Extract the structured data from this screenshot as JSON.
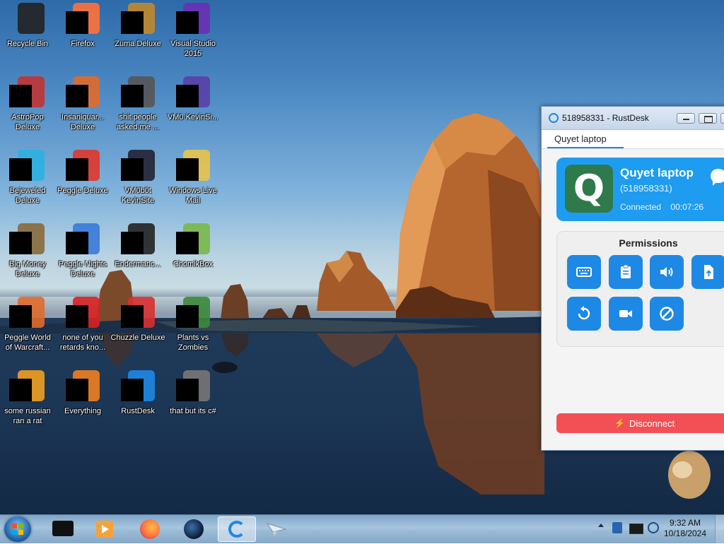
{
  "desktop": {
    "icons": [
      {
        "label": "Recycle Bin"
      },
      {
        "label": "Firefox"
      },
      {
        "label": "Zuma Deluxe"
      },
      {
        "label": "Visual Studio 2015"
      },
      {
        "label": "AstroPop Deluxe"
      },
      {
        "label": "Insaniquar... Deluxe"
      },
      {
        "label": "shit people asked me ..."
      },
      {
        "label": "VM0 KevinSi..."
      },
      {
        "label": "Bejeweled Deluxe"
      },
      {
        "label": "Peggle Deluxe"
      },
      {
        "label": "VM0b0t KevinSite"
      },
      {
        "label": "Windows Live Mail"
      },
      {
        "label": "Big Money Deluxe"
      },
      {
        "label": "Peggle Nights Deluxe"
      },
      {
        "label": "Endermanc..."
      },
      {
        "label": "ChomikBox"
      },
      {
        "label": "Peggle World of Warcraft..."
      },
      {
        "label": "none of you retards kno..."
      },
      {
        "label": "Chuzzle Deluxe"
      },
      {
        "label": "Plants vs Zombies"
      },
      {
        "label": "some russian ran a rat"
      },
      {
        "label": "Everything"
      },
      {
        "label": "RustDesk"
      },
      {
        "label": "that but its c#"
      }
    ]
  },
  "rustdesk": {
    "window_title": "518958331 - RustDesk",
    "tab_label": "Quyet laptop",
    "avatar_letter": "Q",
    "peer_name": "Quyet laptop",
    "peer_id": "(518958331)",
    "status": "Connected",
    "duration": "00:07:26",
    "permissions_title": "Permissions",
    "permissions": [
      {
        "icon": "keyboard-icon"
      },
      {
        "icon": "clipboard-icon"
      },
      {
        "icon": "audio-icon"
      },
      {
        "icon": "file-transfer-icon"
      },
      {
        "icon": "restart-icon"
      },
      {
        "icon": "recording-icon"
      },
      {
        "icon": "block-input-icon"
      }
    ],
    "disconnect_label": "Disconnect",
    "colors": {
      "accent": "#1e88e5",
      "card": "#1e9cf0",
      "avatar": "#2e7a4a",
      "disconnect": "#f25055"
    }
  },
  "taskbar": {
    "time": "9:32 AM",
    "date": "10/18/2024",
    "pinned": [
      "terminal-icon",
      "media-player-icon",
      "firefox-icon",
      "earth-icon",
      "rustdesk-icon",
      "paper-plane-icon"
    ]
  }
}
